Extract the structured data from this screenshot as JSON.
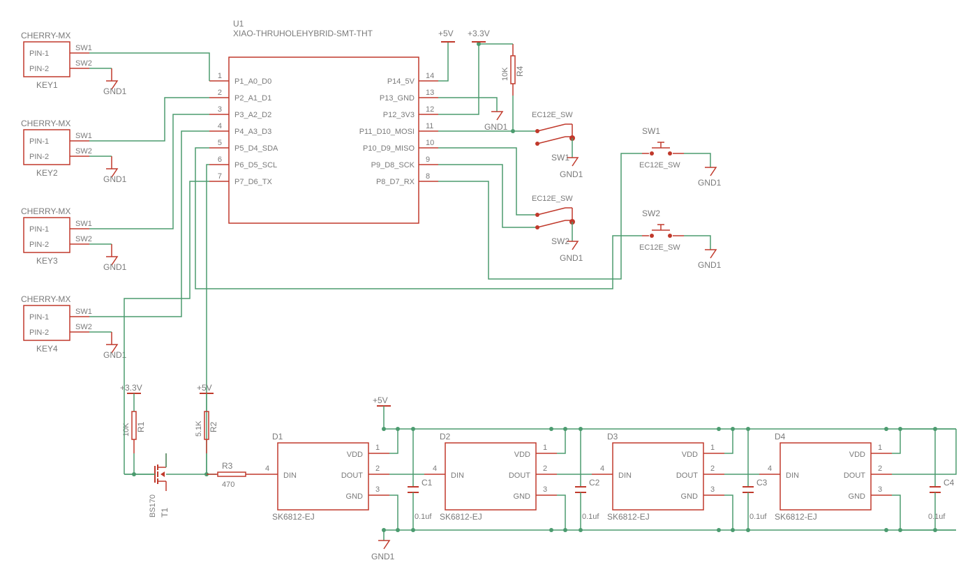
{
  "mcu": {
    "ref": "U1",
    "footprint": "XIAO-THRUHOLEHYBRID-SMT-THT",
    "pins_left": [
      {
        "num": "1",
        "name": "P1_A0_D0"
      },
      {
        "num": "2",
        "name": "P2_A1_D1"
      },
      {
        "num": "3",
        "name": "P3_A2_D2"
      },
      {
        "num": "4",
        "name": "P4_A3_D3"
      },
      {
        "num": "5",
        "name": "P5_D4_SDA"
      },
      {
        "num": "6",
        "name": "P6_D5_SCL"
      },
      {
        "num": "7",
        "name": "P7_D6_TX"
      }
    ],
    "pins_right": [
      {
        "num": "14",
        "name": "P14_5V"
      },
      {
        "num": "13",
        "name": "P13_GND"
      },
      {
        "num": "12",
        "name": "P12_3V3"
      },
      {
        "num": "11",
        "name": "P11_D10_MOSI"
      },
      {
        "num": "10",
        "name": "P10_D9_MISO"
      },
      {
        "num": "9",
        "name": "P9_D8_SCK"
      },
      {
        "num": "8",
        "name": "P8_D7_RX"
      }
    ]
  },
  "keys": [
    {
      "ref": "KEY1",
      "type": "CHERRY-MX",
      "p1": "PIN-1",
      "p2": "PIN-2",
      "n1": "SW1",
      "n2": "SW2",
      "gnd": "GND1"
    },
    {
      "ref": "KEY2",
      "type": "CHERRY-MX",
      "p1": "PIN-1",
      "p2": "PIN-2",
      "n1": "SW1",
      "n2": "SW2",
      "gnd": "GND1"
    },
    {
      "ref": "KEY3",
      "type": "CHERRY-MX",
      "p1": "PIN-1",
      "p2": "PIN-2",
      "n1": "SW1",
      "n2": "SW2",
      "gnd": "GND1"
    },
    {
      "ref": "KEY4",
      "type": "CHERRY-MX",
      "p1": "PIN-1",
      "p2": "PIN-2",
      "n1": "SW1",
      "n2": "SW2",
      "gnd": "GND1"
    }
  ],
  "power": {
    "v5": "+5V",
    "v33": "+3.3V",
    "gnd": "GND1"
  },
  "resistors": {
    "r1": {
      "ref": "R1",
      "val": "10K"
    },
    "r2": {
      "ref": "R2",
      "val": "5.1K"
    },
    "r3": {
      "ref": "R3",
      "val": "470"
    },
    "r4": {
      "ref": "R4",
      "val": "10K"
    }
  },
  "transistor": {
    "ref": "T1",
    "val": "BS170"
  },
  "encoders": {
    "sw1": {
      "ref": "SW1",
      "type": "EC12E_SW",
      "gnd": "GND1"
    },
    "sw2": {
      "ref": "SW2",
      "type": "EC12E_SW",
      "gnd": "GND1"
    },
    "enc1": {
      "ref": "SW1",
      "type": "EC12E_SW",
      "gnd": "GND1"
    },
    "enc2": {
      "ref": "SW2",
      "type": "EC12E_SW",
      "gnd": "GND1"
    }
  },
  "leds": [
    {
      "ref": "D1",
      "part": "SK6812-EJ",
      "vdd": "VDD",
      "din": "DIN",
      "dout": "DOUT",
      "gnd": "GND",
      "p1": "1",
      "p2": "2",
      "p3": "3",
      "p4": "4"
    },
    {
      "ref": "D2",
      "part": "SK6812-EJ",
      "vdd": "VDD",
      "din": "DIN",
      "dout": "DOUT",
      "gnd": "GND",
      "p1": "1",
      "p2": "2",
      "p3": "3",
      "p4": "4"
    },
    {
      "ref": "D3",
      "part": "SK6812-EJ",
      "vdd": "VDD",
      "din": "DIN",
      "dout": "DOUT",
      "gnd": "GND",
      "p1": "1",
      "p2": "2",
      "p3": "3",
      "p4": "4"
    },
    {
      "ref": "D4",
      "part": "SK6812-EJ",
      "vdd": "VDD",
      "din": "DIN",
      "dout": "DOUT",
      "gnd": "GND",
      "p1": "1",
      "p2": "2",
      "p3": "3",
      "p4": "4"
    }
  ],
  "caps": [
    {
      "ref": "C1",
      "val": "0.1uf"
    },
    {
      "ref": "C2",
      "val": "0.1uf"
    },
    {
      "ref": "C3",
      "val": "0.1uf"
    },
    {
      "ref": "C4",
      "val": "0.1uf"
    }
  ]
}
